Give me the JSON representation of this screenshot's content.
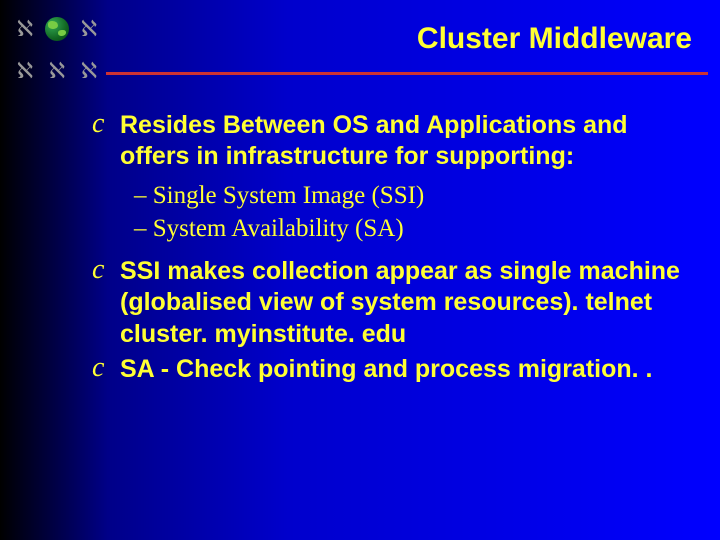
{
  "title": "Cluster Middleware",
  "bullets": [
    {
      "text": "Resides Between OS and Applications and offers in infrastructure for supporting:",
      "subitems": [
        "– Single System Image (SSI)",
        "– System Availability (SA)"
      ]
    },
    {
      "text": "SSI makes collection appear as single machine (globalised view of system resources). telnet cluster. myinstitute. edu",
      "subitems": []
    },
    {
      "text": "SA - Check pointing and process migration. .",
      "subitems": []
    }
  ],
  "decor_glyph": "ℵ"
}
